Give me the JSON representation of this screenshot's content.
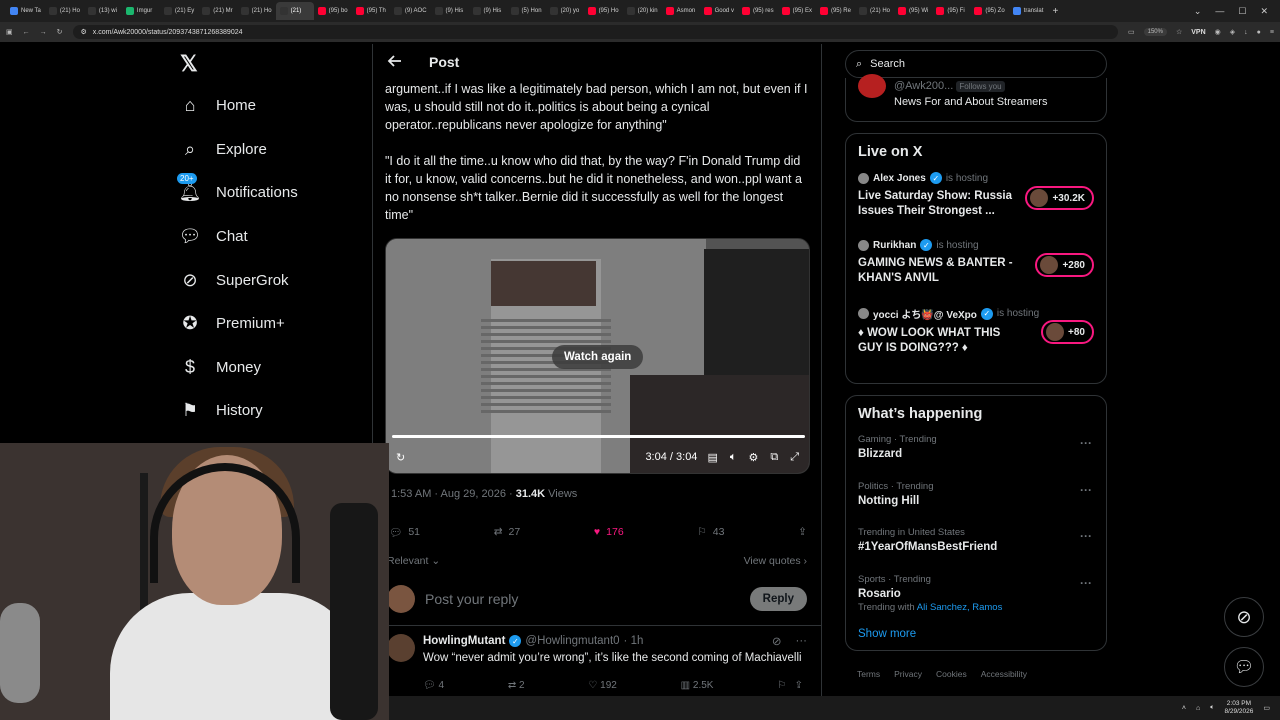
{
  "browser": {
    "tabs": [
      {
        "label": "New Ta",
        "color": "#4285f4"
      },
      {
        "label": "(21) Ho",
        "color": "#333"
      },
      {
        "label": "(13) wi",
        "color": "#333"
      },
      {
        "label": "Imgur",
        "color": "#1bb76e"
      },
      {
        "label": "(21) Ey",
        "color": "#333"
      },
      {
        "label": "(21) Mr",
        "color": "#333"
      },
      {
        "label": "(21) Ho",
        "color": "#333"
      },
      {
        "label": "(21)",
        "color": "#333",
        "active": true
      },
      {
        "label": "(95) bo",
        "color": "#ff0033"
      },
      {
        "label": "(95) Th",
        "color": "#ff0033"
      },
      {
        "label": "(9) AOC",
        "color": "#333"
      },
      {
        "label": "(9) His",
        "color": "#333"
      },
      {
        "label": "(9) His",
        "color": "#333"
      },
      {
        "label": "(5) Hon",
        "color": "#333"
      },
      {
        "label": "(20) yo",
        "color": "#333"
      },
      {
        "label": "(95) Ho",
        "color": "#ff0033"
      },
      {
        "label": "(20) kin",
        "color": "#333"
      },
      {
        "label": "Asmon",
        "color": "#ff0033"
      },
      {
        "label": "Good v",
        "color": "#ff0033"
      },
      {
        "label": "(95) res",
        "color": "#ff0033"
      },
      {
        "label": "(95) Ex",
        "color": "#ff0033"
      },
      {
        "label": "(95) Re",
        "color": "#ff0033"
      },
      {
        "label": "(21) Ho",
        "color": "#333"
      },
      {
        "label": "(95) Wi",
        "color": "#ff0033"
      },
      {
        "label": "(95) Fi",
        "color": "#ff0033"
      },
      {
        "label": "(95) Zo",
        "color": "#ff0033"
      },
      {
        "label": "translat",
        "color": "#4285f4"
      }
    ],
    "url": "x.com/Awk20000/status/2093743871268389024",
    "zoom": "150%",
    "vpn_label": "VPN"
  },
  "nav": {
    "items": [
      {
        "label": "Home",
        "icon": "home-icon"
      },
      {
        "label": "Explore",
        "icon": "search-icon"
      },
      {
        "label": "Notifications",
        "icon": "bell-icon",
        "badge": "20+"
      },
      {
        "label": "Chat",
        "icon": "chat-icon"
      },
      {
        "label": "SuperGrok",
        "icon": "grok-icon"
      },
      {
        "label": "Premium+",
        "icon": "verified-icon"
      },
      {
        "label": "Money",
        "icon": "dollar-icon"
      },
      {
        "label": "History",
        "icon": "bookmark-icon"
      }
    ]
  },
  "post": {
    "header": "Post",
    "text_1": "argument..if I was like a legitimately bad person, which I am not, but even if I was, u should still not do it..politics is about being a cynical operator..republicans never apologize for anything\"",
    "text_2": "\"I do it all the time..u know who did that, by the way? F'in Donald Trump did it for, u know, valid concerns..but he did it nonetheless, and won..ppl want a no nonsense sh*t talker..Bernie did it successfully as well for the longest time\"",
    "video": {
      "watch_again": "Watch again",
      "time": "3:04 / 3:04",
      "progress": 1.0
    },
    "time": "1:53 AM · Aug 29, 2026 · ",
    "views_count": "31.4K",
    "views_label": " Views",
    "stats": {
      "replies": "51",
      "reposts": "27",
      "likes": "176",
      "bookmarks": "43"
    },
    "sort_label": "Relevant",
    "view_quotes": "View quotes",
    "reply_placeholder": "Post your reply",
    "reply_button": "Reply"
  },
  "reply": {
    "name": "HowlingMutant",
    "handle": "@Howlingmutant0",
    "time": "· 1h",
    "text": "Wow “never admit you’re wrong”, it’s like the second coming of Machiavelli",
    "stats": {
      "replies": "4",
      "reposts": "2",
      "likes": "192",
      "views": "2.5K"
    }
  },
  "sidebar": {
    "search_placeholder": "Search",
    "top_card": {
      "handle": "@Awk200...",
      "follows": "Follows you",
      "desc": "News For and About Streamers"
    },
    "live_title": "Live on X",
    "live": [
      {
        "host": "Alex Jones",
        "is": "is hosting",
        "title": "Live Saturday Show: Russia Issues Their Strongest ...",
        "viewers": "+30.2K"
      },
      {
        "host": "Rurikhan",
        "is": "is hosting",
        "title": "GAMING NEWS & BANTER - KHAN'S ANVIL",
        "viewers": "+280"
      },
      {
        "host": "yocci よち👹@ VeXpo",
        "is": "is hosting",
        "title": "♦ WOW LOOK WHAT THIS GUY IS DOING??? ♦",
        "viewers": "+80"
      }
    ],
    "happening_title": "What’s happening",
    "trends": [
      {
        "meta": "Gaming · Trending",
        "name": "Blizzard"
      },
      {
        "meta": "Politics · Trending",
        "name": "Notting Hill"
      },
      {
        "meta": "Trending in United States",
        "name": "#1YearOfMansBestFriend"
      },
      {
        "meta": "Sports · Trending",
        "name": "Rosario",
        "with_label": "Trending with ",
        "with": "Ali Sanchez, Ramos"
      }
    ],
    "show_more": "Show more",
    "footer": [
      "Terms",
      "Privacy",
      "Cookies",
      "Accessibility"
    ]
  },
  "taskbar": {
    "time": "2:03 PM",
    "date": "8/29/2026"
  }
}
